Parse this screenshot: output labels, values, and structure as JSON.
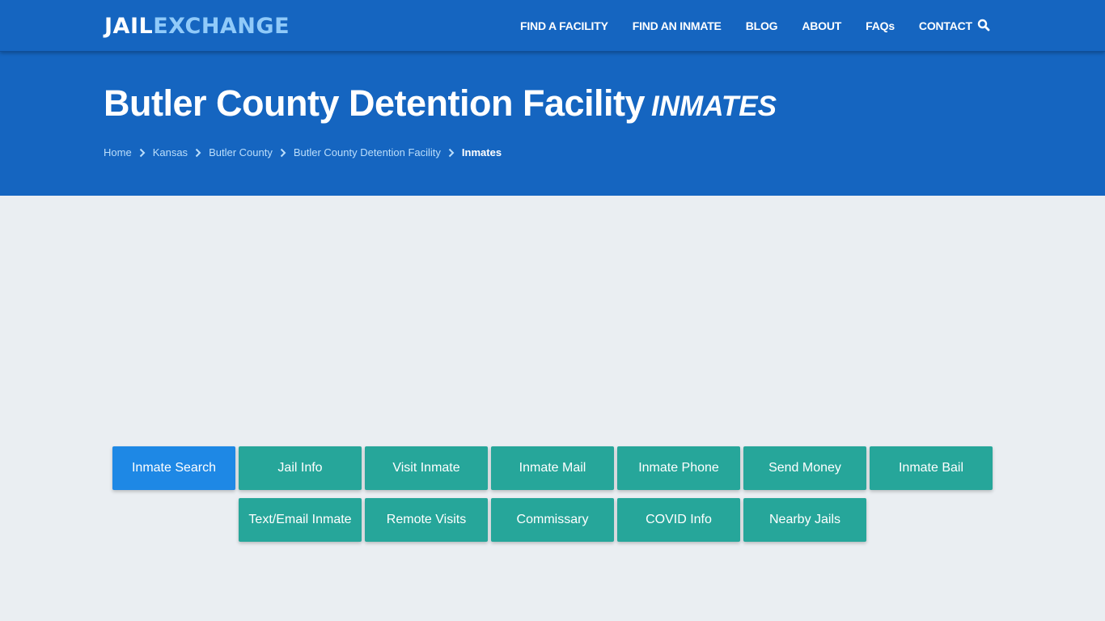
{
  "header": {
    "logo": {
      "part1": "JAIL",
      "part2": "EXCHANGE"
    },
    "nav": [
      {
        "label": "FIND A FACILITY"
      },
      {
        "label": "FIND AN INMATE"
      },
      {
        "label": "BLOG"
      },
      {
        "label": "ABOUT"
      },
      {
        "label": "FAQs"
      },
      {
        "label": "CONTACT"
      }
    ],
    "search_icon": "search-icon"
  },
  "hero": {
    "title": "Butler County Detention Facility",
    "subtitle": "INMATES",
    "breadcrumb": [
      {
        "label": "Home"
      },
      {
        "label": "Kansas"
      },
      {
        "label": "Butler County"
      },
      {
        "label": "Butler County Detention Facility"
      },
      {
        "label": "Inmates"
      }
    ]
  },
  "actions": [
    {
      "label": "Inmate Search",
      "active": true
    },
    {
      "label": "Jail Info"
    },
    {
      "label": "Visit Inmate"
    },
    {
      "label": "Inmate Mail"
    },
    {
      "label": "Inmate Phone"
    },
    {
      "label": "Send Money"
    },
    {
      "label": "Inmate Bail"
    },
    {
      "label": "Text/Email Inmate"
    },
    {
      "label": "Remote Visits"
    },
    {
      "label": "Commissary"
    },
    {
      "label": "COVID Info"
    },
    {
      "label": "Nearby Jails"
    }
  ],
  "colors": {
    "brand_blue": "#1565c0",
    "logo_accent": "#90caf9",
    "active_button": "#1e88e5",
    "button_teal": "#26a69a",
    "page_background": "#eaeef2"
  }
}
